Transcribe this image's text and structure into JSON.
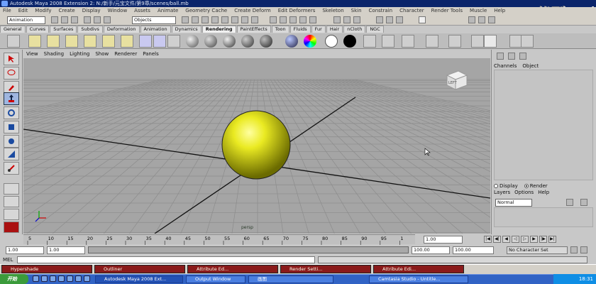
{
  "window": {
    "title": "Autodesk Maya 2008 Extension 2: N:/新手/元宝文件/第9章/scenes/ball.mb"
  },
  "watermark": {
    "main": "优酷",
    "sub": "i"
  },
  "menubar": {
    "items": [
      "File",
      "Edit",
      "Modify",
      "Create",
      "Display",
      "Window",
      "Assets",
      "Animate",
      "Geometry Cache",
      "Create Deform",
      "Edit Deformers",
      "Skeleton",
      "Skin",
      "Constrain",
      "Character",
      "Render Tools",
      "Muscle",
      "Help"
    ]
  },
  "statusline": {
    "mode": "Animation",
    "selection_mask": "Objects"
  },
  "shelf": {
    "tabs": [
      "General",
      "Curves",
      "Surfaces",
      "Subdivs",
      "Deformation",
      "Animation",
      "Dynamics",
      "Rendering",
      "PaintEffects",
      "Toon",
      "Fluids",
      "Fur",
      "Hair",
      "nCloth",
      "NGC"
    ],
    "active_tab": "Rendering"
  },
  "viewport": {
    "menu": [
      "View",
      "Shading",
      "Lighting",
      "Show",
      "Renderer",
      "Panels"
    ],
    "camera_label": "persp",
    "viewcube_face": "LEFT",
    "sphere_color": "#e4e41a"
  },
  "channel_box": {
    "menu": [
      "Channels",
      "Object"
    ],
    "display_label": "Display",
    "render_label": "Render",
    "layer_menu": [
      "Layers",
      "Options",
      "Help"
    ],
    "layer_mode": "Normal"
  },
  "timeslider": {
    "ticks": [
      "5",
      "10",
      "15",
      "20",
      "25",
      "30",
      "35",
      "40",
      "45",
      "50",
      "55",
      "60",
      "65",
      "70",
      "75",
      "80",
      "85",
      "90",
      "95",
      "1"
    ],
    "current_frame": "1.00"
  },
  "range": {
    "start": "1.00",
    "inner_start": "1.00",
    "inner_end": "100.00",
    "end": "100.00",
    "character_set": "No Character Set"
  },
  "mel": {
    "label": "MEL"
  },
  "task_windows": [
    {
      "label": "Hypershade"
    },
    {
      "label": "Outliner"
    },
    {
      "label": "Attribute Ed..."
    },
    {
      "label": "Render Setti..."
    },
    {
      "label": "Attribute Edi..."
    }
  ],
  "taskbar": {
    "start": "开始",
    "buttons": [
      {
        "label": "Autodesk Maya 2008 Ext..."
      },
      {
        "label": "Output Window"
      },
      {
        "label": "画图"
      },
      {
        "label": "Camtasia Studio - Untitle..."
      }
    ],
    "clock": "18:31"
  },
  "colors": {
    "title_bar": "#0a246a",
    "viewport_bg": "#a5a5a5",
    "taskbar": "#3163c5",
    "task_window": "#8a1a1a"
  }
}
